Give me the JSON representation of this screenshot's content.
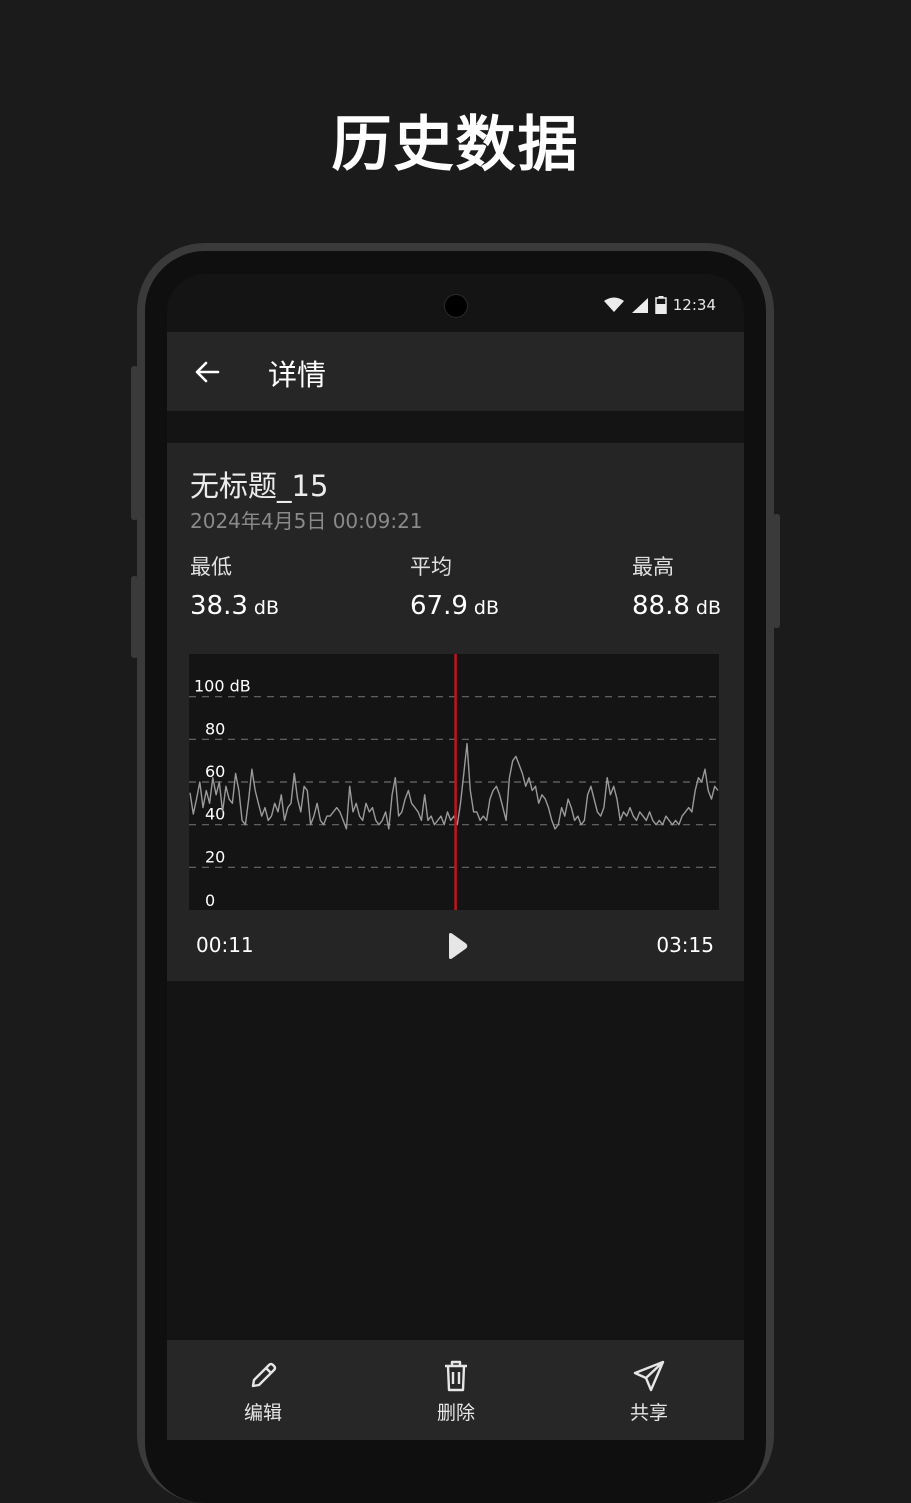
{
  "headline": "历史数据",
  "status_bar": {
    "time": "12:34",
    "icons": [
      "wifi-icon",
      "signal-icon",
      "battery-icon"
    ]
  },
  "appbar": {
    "back_icon": "arrow-left-icon",
    "title": "详情"
  },
  "record": {
    "title": "无标题_15",
    "date": "2024年4月5日 00:09:21",
    "stats": [
      {
        "label": "最低",
        "value": "38.3",
        "unit": "dB"
      },
      {
        "label": "平均",
        "value": "67.9",
        "unit": "dB"
      },
      {
        "label": "最高",
        "value": "88.8",
        "unit": "dB"
      }
    ]
  },
  "chart_data": {
    "type": "line",
    "y_tick_labels": [
      "100 dB",
      "80",
      "60",
      "40",
      "20",
      "0"
    ],
    "y_ticks": [
      100,
      80,
      60,
      40,
      20,
      0
    ],
    "ylim": [
      0,
      120
    ],
    "grid": "dashed-horizontal",
    "playhead_fraction": 0.503,
    "series": [
      {
        "values": [
          55,
          45,
          52,
          60,
          48,
          56,
          50,
          62,
          54,
          60,
          46,
          58,
          52,
          50,
          64,
          56,
          42,
          40,
          52,
          66,
          56,
          50,
          44,
          48,
          42,
          44,
          50,
          46,
          54,
          42,
          48,
          50,
          64,
          52,
          46,
          58,
          56,
          40,
          44,
          50,
          42,
          40,
          44,
          44,
          46,
          48,
          46,
          42,
          38,
          58,
          46,
          50,
          44,
          42,
          50,
          46,
          48,
          42,
          40,
          42,
          46,
          38,
          54,
          62,
          44,
          46,
          52,
          56,
          50,
          48,
          46,
          42,
          54,
          42,
          44,
          40,
          42,
          44,
          40,
          46,
          42,
          44,
          40,
          50,
          64,
          78,
          56,
          46,
          46,
          42,
          44,
          42,
          52,
          56,
          58,
          54,
          48,
          42,
          62,
          70,
          72,
          68,
          64,
          58,
          62,
          56,
          58,
          50,
          54,
          52,
          48,
          42,
          38,
          40,
          48,
          44,
          52,
          48,
          42,
          44,
          40,
          42,
          54,
          58,
          52,
          46,
          44,
          48,
          62,
          54,
          58,
          52,
          42,
          46,
          44,
          48,
          44,
          42,
          46,
          44,
          42,
          46,
          42,
          40,
          42,
          40,
          44,
          42,
          40,
          42,
          40,
          44,
          46,
          48,
          46,
          56,
          62,
          60,
          66,
          56,
          52,
          58,
          56
        ]
      }
    ],
    "x_start_label": "00:11",
    "x_end_label": "03:15",
    "line_color": "#9a9a9a",
    "playhead_color": "#c0141c"
  },
  "player": {
    "elapsed": "00:11",
    "duration": "03:15",
    "play_icon": "play-icon"
  },
  "actions": [
    {
      "label": "编辑",
      "icon": "pencil-icon"
    },
    {
      "label": "删除",
      "icon": "trash-icon"
    },
    {
      "label": "共享",
      "icon": "send-icon"
    }
  ]
}
